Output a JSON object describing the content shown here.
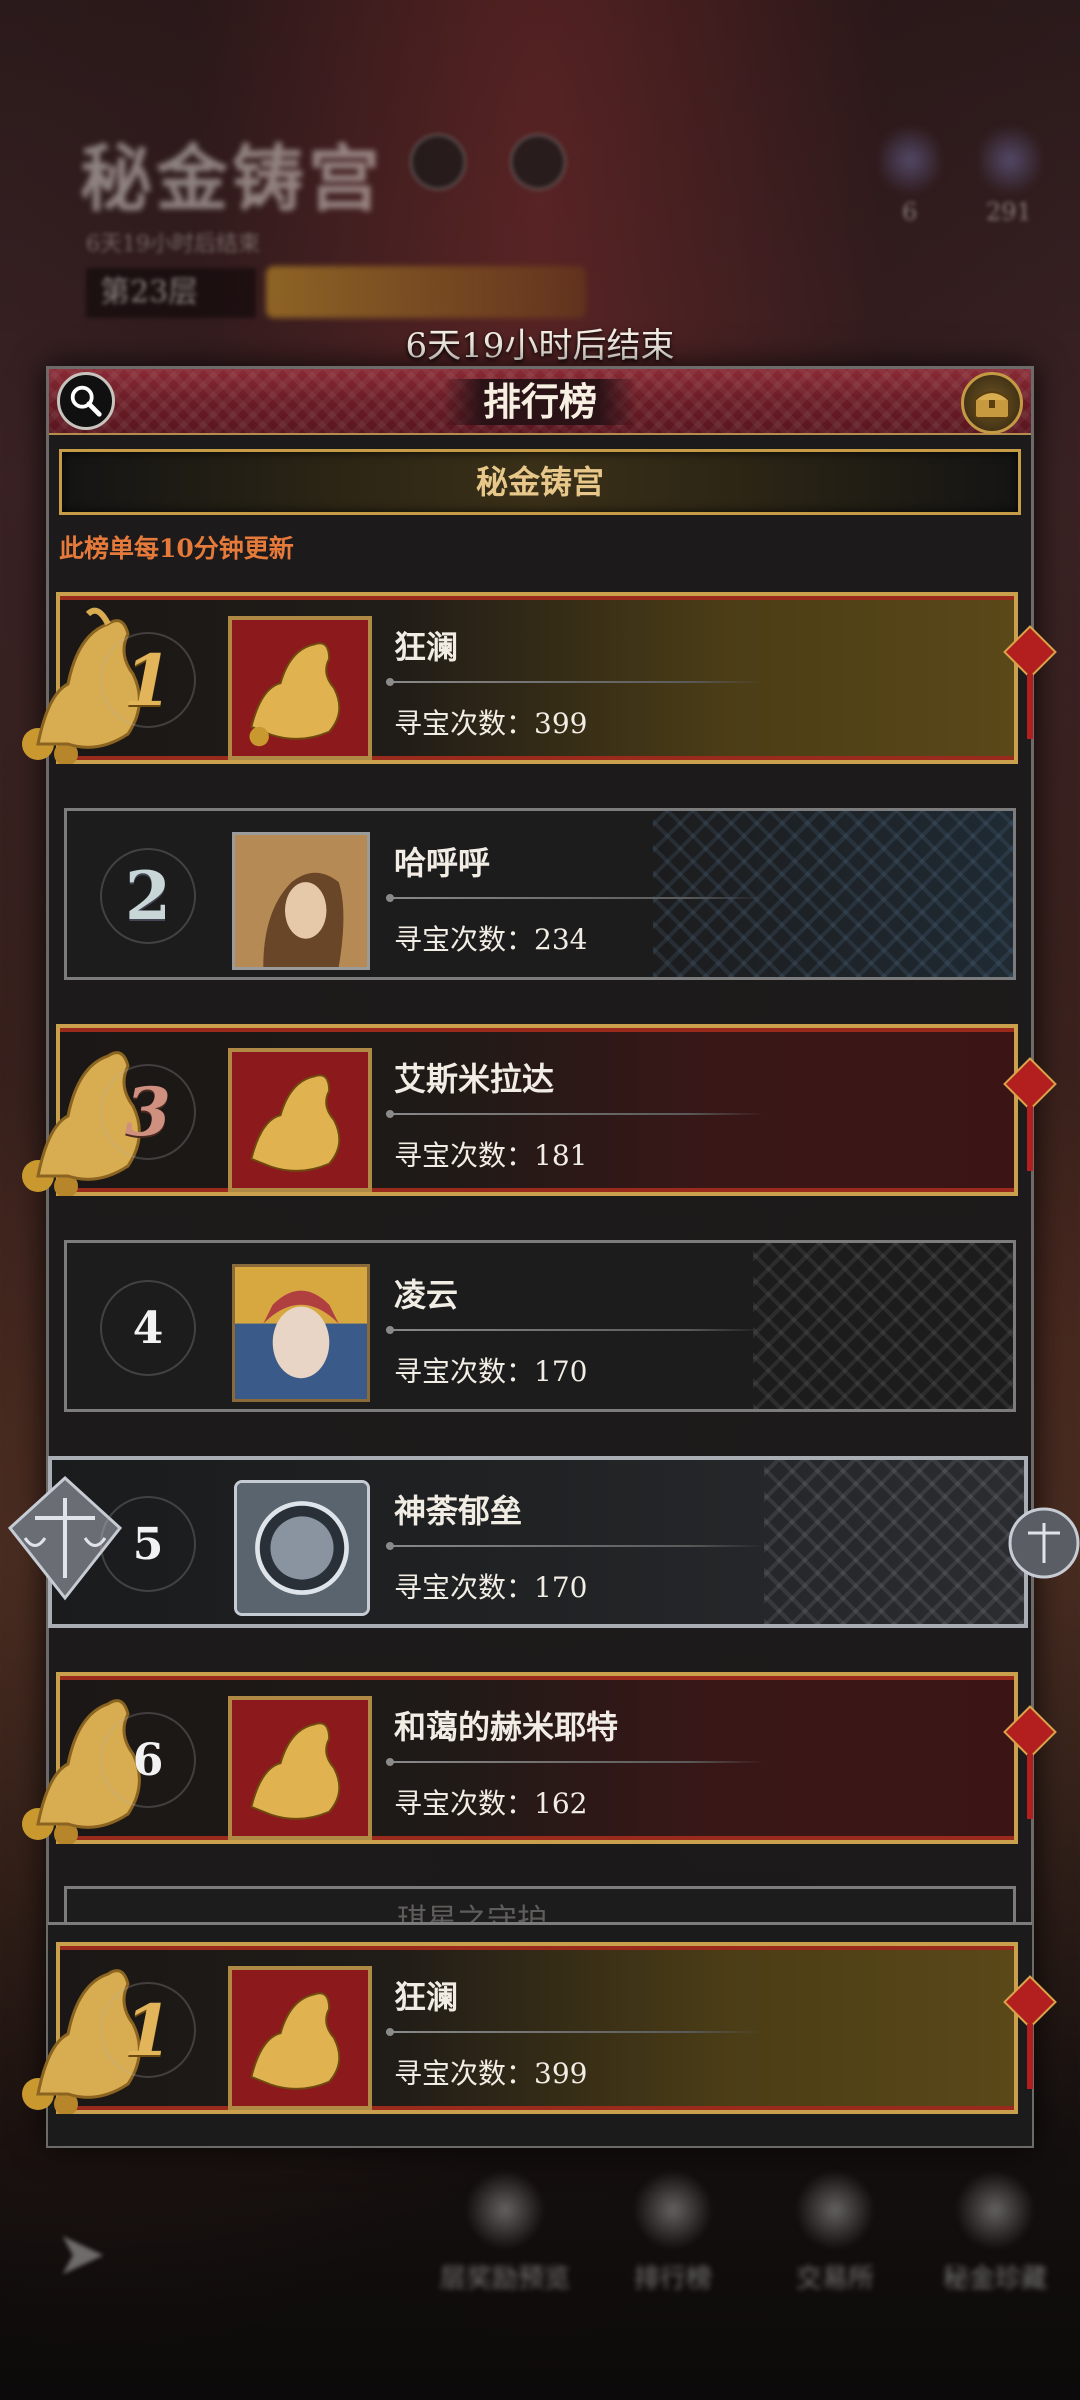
{
  "background": {
    "title": "秘金铸宫",
    "subtitle": "6天19小时后结束",
    "floor": "第23层",
    "resources": [
      "6",
      "291"
    ],
    "nav": [
      "层奖励预览",
      "排行榜",
      "交易所",
      "秘金珍藏"
    ]
  },
  "timer": "6天19小时后结束",
  "panel": {
    "title": "排行榜",
    "subtitle": "秘金铸宫",
    "update_note": "此榜单每10分钟更新"
  },
  "count_label": "寻宝次数：",
  "rows": [
    {
      "rank": "1",
      "name": "狂澜",
      "count": "399",
      "style": "gold-first"
    },
    {
      "rank": "2",
      "name": "哈呼呼",
      "count": "234",
      "style": "blue"
    },
    {
      "rank": "3",
      "name": "艾斯米拉达",
      "count": "181",
      "style": "gold"
    },
    {
      "rank": "4",
      "name": "凌云",
      "count": "170",
      "style": "plain"
    },
    {
      "rank": "5",
      "name": "神荼郁垒",
      "count": "170",
      "style": "silver"
    },
    {
      "rank": "6",
      "name": "和蔼的赫米耶特",
      "count": "162",
      "style": "gold"
    }
  ],
  "my_rank": {
    "rank": "1",
    "name": "狂澜",
    "count": "399"
  },
  "partial_row_name": "琪星之守护",
  "colors": {
    "gold": "#caa04c",
    "accent_orange": "#e57a3a",
    "header_red": "#6a1c25"
  }
}
